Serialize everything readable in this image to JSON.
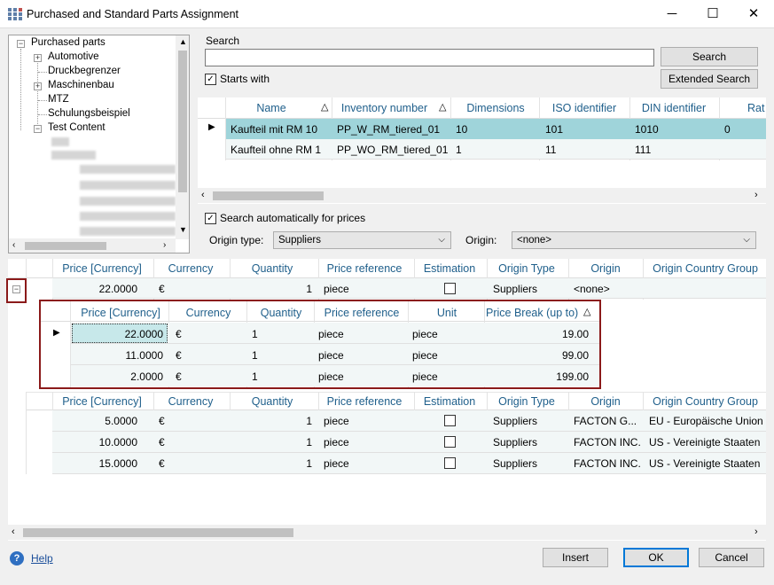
{
  "window": {
    "title": "Purchased and Standard Parts Assignment",
    "minimize": "─",
    "maximize": "☐",
    "close": "✕"
  },
  "tree": {
    "root": "Purchased parts",
    "items": [
      {
        "label": "Automotive",
        "expandable": true
      },
      {
        "label": "Druckbegrenzer",
        "expandable": false
      },
      {
        "label": "Maschinenbau",
        "expandable": true
      },
      {
        "label": "MTZ",
        "expandable": false
      },
      {
        "label": "Schulungsbeispiel",
        "expandable": false
      },
      {
        "label": "Test Content",
        "expandable": true
      }
    ]
  },
  "search": {
    "label": "Search",
    "value": "",
    "search_button": "Search",
    "extended_button": "Extended Search",
    "starts_with": "Starts with"
  },
  "parts_grid": {
    "columns": [
      "Name",
      "Inventory number",
      "Dimensions",
      "ISO identifier",
      "DIN identifier",
      "Rati"
    ],
    "rows": [
      [
        "Kaufteil mit RM 10",
        "PP_W_RM_tiered_01",
        "10",
        "101",
        "1010",
        "0"
      ],
      [
        "Kaufteil ohne RM 1",
        "PP_WO_RM_tiered_01",
        "1",
        "11",
        "111",
        ""
      ]
    ]
  },
  "options": {
    "auto_search": "Search automatically for prices",
    "origin_type_label": "Origin type:",
    "origin_type_value": "Suppliers",
    "origin_label": "Origin:",
    "origin_value": "<none>"
  },
  "price_grid": {
    "columns": [
      "Price [Currency]",
      "Currency",
      "Quantity",
      "Price reference",
      "Estimation",
      "Origin Type",
      "Origin",
      "Origin Country Group"
    ],
    "row": [
      "22.0000",
      "€",
      "1",
      "piece",
      "",
      "Suppliers",
      "<none>",
      ""
    ],
    "collapse": "−"
  },
  "breaks_grid": {
    "columns": [
      "Price [Currency]",
      "Currency",
      "Quantity",
      "Price reference",
      "Unit",
      "Price Break (up to)"
    ],
    "rows": [
      [
        "22.0000",
        "€",
        "1",
        "piece",
        "piece",
        "19.00"
      ],
      [
        "11.0000",
        "€",
        "1",
        "piece",
        "piece",
        "99.00"
      ],
      [
        "2.0000",
        "€",
        "1",
        "piece",
        "piece",
        "199.00"
      ]
    ]
  },
  "price_grid2": {
    "columns": [
      "Price [Currency]",
      "Currency",
      "Quantity",
      "Price reference",
      "Estimation",
      "Origin Type",
      "Origin",
      "Origin Country Group"
    ],
    "rows": [
      [
        "5.0000",
        "€",
        "1",
        "piece",
        "",
        "Suppliers",
        "FACTON G...",
        "EU - Europäische Union"
      ],
      [
        "10.0000",
        "€",
        "1",
        "piece",
        "",
        "Suppliers",
        "FACTON INC.",
        "US - Vereinigte Staaten"
      ],
      [
        "15.0000",
        "€",
        "1",
        "piece",
        "",
        "Suppliers",
        "FACTON INC.",
        "US - Vereinigte Staaten"
      ]
    ]
  },
  "footer": {
    "help": "Help",
    "insert": "Insert",
    "ok": "OK",
    "cancel": "Cancel"
  },
  "colors": {
    "header_text": "#1f5f8b",
    "selection": "#9fd4da",
    "highlight_box": "#8b1a1a",
    "primary_border": "#0078d7"
  }
}
